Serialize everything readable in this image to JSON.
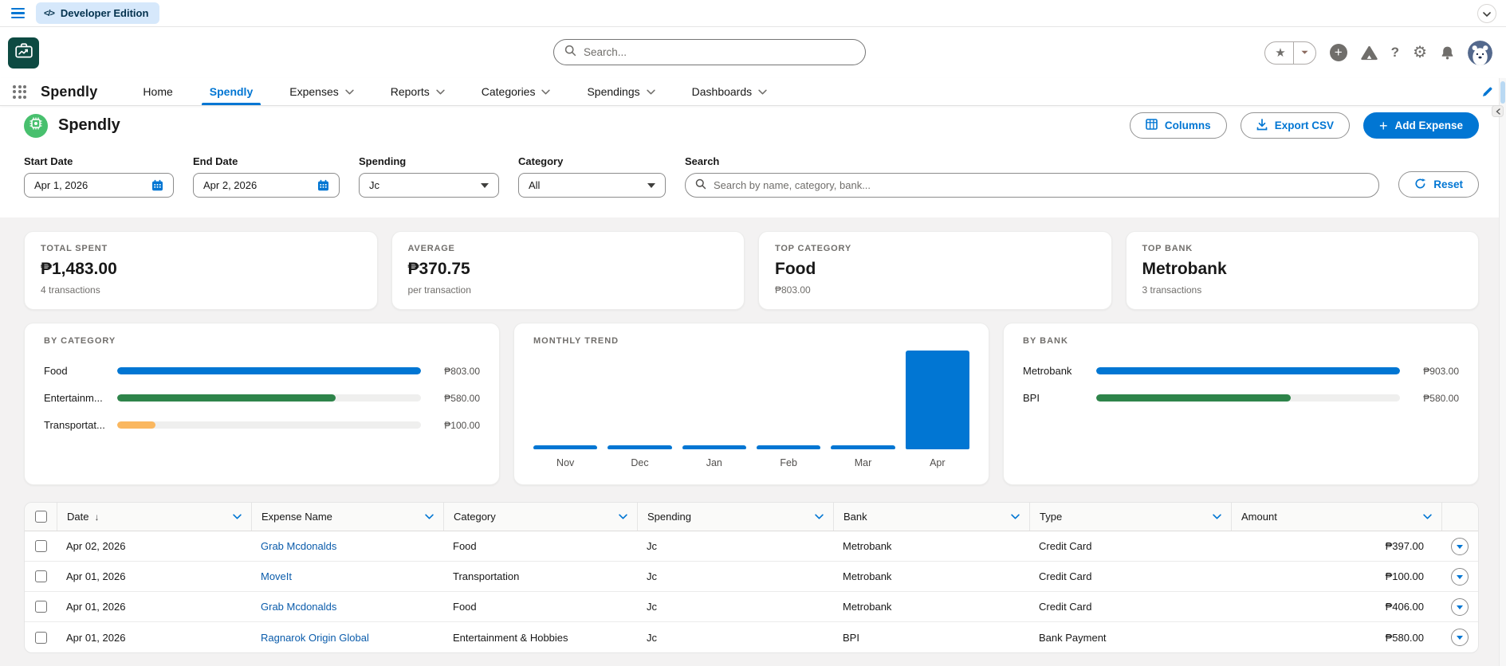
{
  "topbar": {
    "dev_badge_label": "Developer Edition"
  },
  "header": {
    "search_placeholder": "Search..."
  },
  "nav": {
    "app_name": "Spendly",
    "tabs": [
      {
        "label": "Home",
        "caret": false,
        "active": false
      },
      {
        "label": "Spendly",
        "caret": false,
        "active": true
      },
      {
        "label": "Expenses",
        "caret": true,
        "active": false
      },
      {
        "label": "Reports",
        "caret": true,
        "active": false
      },
      {
        "label": "Categories",
        "caret": true,
        "active": false
      },
      {
        "label": "Spendings",
        "caret": true,
        "active": false
      },
      {
        "label": "Dashboards",
        "caret": true,
        "active": false
      }
    ]
  },
  "page": {
    "title": "Spendly",
    "actions": {
      "columns": "Columns",
      "export_csv": "Export CSV",
      "add_expense": "Add Expense"
    }
  },
  "filters": {
    "start_date": {
      "label": "Start Date",
      "value": "Apr 1, 2026"
    },
    "end_date": {
      "label": "End Date",
      "value": "Apr 2, 2026"
    },
    "spending": {
      "label": "Spending",
      "value": "Jc"
    },
    "category": {
      "label": "Category",
      "value": "All"
    },
    "search": {
      "label": "Search",
      "placeholder": "Search by name, category, bank..."
    },
    "reset_label": "Reset"
  },
  "stats": [
    {
      "label": "TOTAL SPENT",
      "value": "₱1,483.00",
      "sub": "4 transactions"
    },
    {
      "label": "AVERAGE",
      "value": "₱370.75",
      "sub": "per transaction"
    },
    {
      "label": "TOP CATEGORY",
      "value": "Food",
      "sub": "₱803.00"
    },
    {
      "label": "TOP BANK",
      "value": "Metrobank",
      "sub": "3 transactions"
    }
  ],
  "chart_data": [
    {
      "type": "bar",
      "orientation": "horizontal",
      "title": "BY CATEGORY",
      "categories": [
        "Food",
        "Entertainment & Hobbies",
        "Transportation"
      ],
      "display_labels": [
        "Food",
        "Entertainm...",
        "Transportat..."
      ],
      "values": [
        803,
        580,
        100
      ],
      "value_labels": [
        "₱803.00",
        "₱580.00",
        "₱100.00"
      ],
      "pct": [
        100,
        72,
        12.5
      ],
      "colors": [
        "#0176d3",
        "#2e844a",
        "#fab75f"
      ],
      "xlim": [
        0,
        803
      ],
      "grid": false
    },
    {
      "type": "bar",
      "orientation": "vertical",
      "title": "MONTHLY TREND",
      "categories": [
        "Nov",
        "Dec",
        "Jan",
        "Feb",
        "Mar",
        "Apr"
      ],
      "values": [
        0,
        0,
        0,
        0,
        0,
        1483
      ],
      "pct": [
        0,
        0,
        0,
        0,
        0,
        100
      ],
      "color": "#0176d3",
      "ylim": [
        0,
        1483
      ],
      "grid": false
    },
    {
      "type": "bar",
      "orientation": "horizontal",
      "title": "BY BANK",
      "categories": [
        "Metrobank",
        "BPI"
      ],
      "values": [
        903,
        580
      ],
      "value_labels": [
        "₱903.00",
        "₱580.00"
      ],
      "pct": [
        100,
        64
      ],
      "colors": [
        "#0176d3",
        "#2e844a"
      ],
      "xlim": [
        0,
        903
      ],
      "grid": false
    }
  ],
  "table": {
    "headers": [
      "Date",
      "Expense Name",
      "Category",
      "Spending",
      "Bank",
      "Type",
      "Amount"
    ],
    "sort_indicator": "↓",
    "rows": [
      {
        "date": "Apr 02, 2026",
        "name": "Grab Mcdonalds",
        "category": "Food",
        "spending": "Jc",
        "bank": "Metrobank",
        "type": "Credit Card",
        "amount": "₱397.00"
      },
      {
        "date": "Apr 01, 2026",
        "name": "MoveIt",
        "category": "Transportation",
        "spending": "Jc",
        "bank": "Metrobank",
        "type": "Credit Card",
        "amount": "₱100.00"
      },
      {
        "date": "Apr 01, 2026",
        "name": "Grab Mcdonalds",
        "category": "Food",
        "spending": "Jc",
        "bank": "Metrobank",
        "type": "Credit Card",
        "amount": "₱406.00"
      },
      {
        "date": "Apr 01, 2026",
        "name": "Ragnarok Origin Global",
        "category": "Entertainment & Hobbies",
        "spending": "Jc",
        "bank": "BPI",
        "type": "Bank Payment",
        "amount": "₱580.00"
      }
    ]
  }
}
